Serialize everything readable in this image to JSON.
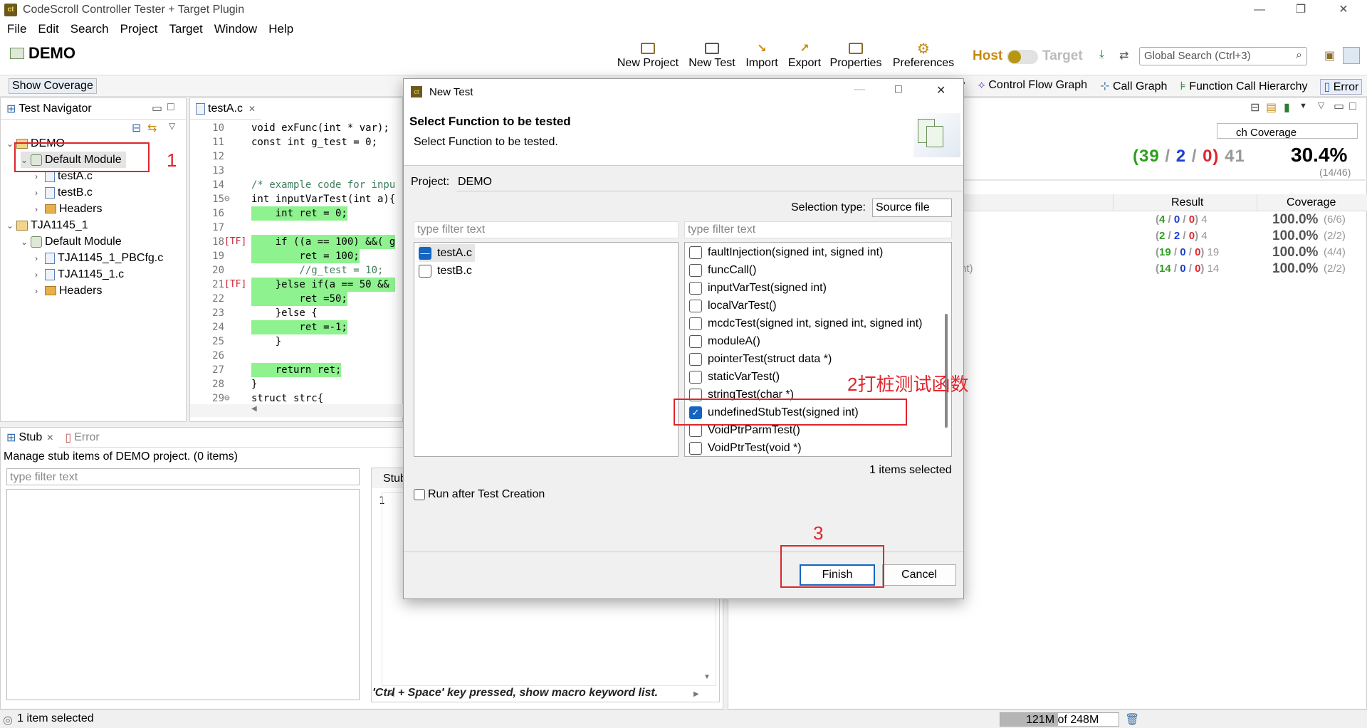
{
  "window": {
    "title": "CodeScroll Controller Tester + Target Plugin",
    "app_icon": "ct"
  },
  "menu": [
    "File",
    "Edit",
    "Search",
    "Project",
    "Target",
    "Window",
    "Help"
  ],
  "toolbar": {
    "project_name": "DEMO",
    "buttons": [
      "New Project",
      "New Test",
      "Import",
      "Export",
      "Properties",
      "Preferences"
    ],
    "host_label": "Host",
    "target_label": "Target",
    "search_placeholder": "Global Search (Ctrl+3)"
  },
  "viewbar": {
    "show_coverage": "Show Coverage",
    "right_views": [
      "ry",
      "Control Flow Graph",
      "Call Graph",
      "Function Call Hierarchy",
      "Error"
    ]
  },
  "navigator": {
    "tab": "Test Navigator",
    "tree": [
      {
        "label": "DEMO",
        "indent": 0,
        "icon": "project",
        "chev": "v"
      },
      {
        "label": "Default Module",
        "indent": 1,
        "icon": "module",
        "chev": "v",
        "selected": true
      },
      {
        "label": "testA.c",
        "indent": 2,
        "icon": "file",
        "chev": ">"
      },
      {
        "label": "testB.c",
        "indent": 2,
        "icon": "file",
        "chev": ">"
      },
      {
        "label": "Headers",
        "indent": 2,
        "icon": "folder",
        "chev": ">"
      },
      {
        "label": "TJA1145_1",
        "indent": 0,
        "icon": "project",
        "chev": "v"
      },
      {
        "label": "Default Module",
        "indent": 1,
        "icon": "module",
        "chev": "v"
      },
      {
        "label": "TJA1145_1_PBCfg.c",
        "indent": 2,
        "icon": "file",
        "chev": ">"
      },
      {
        "label": "TJA1145_1.c",
        "indent": 2,
        "icon": "file",
        "chev": ">"
      },
      {
        "label": "Headers",
        "indent": 2,
        "icon": "folder",
        "chev": ">"
      }
    ]
  },
  "editor": {
    "tab": "testA.c",
    "lines": [
      {
        "n": "10",
        "mark": "",
        "text": "void exFunc(int * var);",
        "hl": false
      },
      {
        "n": "11",
        "mark": "",
        "text": "const int g_test = 0;",
        "hl": false
      },
      {
        "n": "12",
        "mark": "",
        "text": "",
        "hl": false
      },
      {
        "n": "13",
        "mark": "",
        "text": "",
        "hl": false
      },
      {
        "n": "14",
        "mark": "",
        "text": "/* example code for inpu",
        "hl": false
      },
      {
        "n": "15",
        "mark": "⊖",
        "text": "int inputVarTest(int a){",
        "hl": false
      },
      {
        "n": "16",
        "mark": "",
        "text": "    int ret = 0;",
        "hl": true
      },
      {
        "n": "17",
        "mark": "",
        "text": "",
        "hl": false
      },
      {
        "n": "18",
        "mark": "[TF]",
        "text": "    if ((a == 100) &&( g",
        "hl": true
      },
      {
        "n": "19",
        "mark": "",
        "text": "        ret = 100;",
        "hl": true
      },
      {
        "n": "20",
        "mark": "",
        "text": "        //g_test = 10;",
        "hl": false
      },
      {
        "n": "21",
        "mark": "[TF]",
        "text": "    }else if(a == 50 && ",
        "hl": true
      },
      {
        "n": "22",
        "mark": "",
        "text": "        ret =50;",
        "hl": true
      },
      {
        "n": "23",
        "mark": "",
        "text": "    }else {",
        "hl": false
      },
      {
        "n": "24",
        "mark": "",
        "text": "        ret =-1;",
        "hl": true
      },
      {
        "n": "25",
        "mark": "",
        "text": "    }",
        "hl": false
      },
      {
        "n": "26",
        "mark": "",
        "text": "",
        "hl": false
      },
      {
        "n": "27",
        "mark": "",
        "text": "    return ret;",
        "hl": true
      },
      {
        "n": "28",
        "mark": "",
        "text": "}",
        "hl": false
      },
      {
        "n": "29",
        "mark": "⊖",
        "text": "struct strc{",
        "hl": false
      }
    ]
  },
  "coverage_panel": {
    "search_text": "ch Coverage",
    "summary_counts": [
      "(39",
      "2",
      "0)",
      "41"
    ],
    "summary_pct": "30.4%",
    "summary_ratio": "(14/46)",
    "headers": [
      "Result",
      "Coverage"
    ],
    "rows": [
      {
        "stub_left": "",
        "pass": "4",
        "fail": "0",
        "err": "0",
        "total": "4",
        "pct": "100.0%",
        "ratio": "(6/6)"
      },
      {
        "stub_left": ")",
        "pass": "2",
        "fail": "2",
        "err": "0",
        "total": "4",
        "pct": "100.0%",
        "ratio": "(2/2)"
      },
      {
        "stub_left": "",
        "pass": "19",
        "fail": "0",
        "err": "0",
        "total": "19",
        "pct": "100.0%",
        "ratio": "(4/4)"
      },
      {
        "stub_left": "nt)",
        "pass": "14",
        "fail": "0",
        "err": "0",
        "total": "14",
        "pct": "100.0%",
        "ratio": "(2/2)"
      }
    ]
  },
  "stub_panel": {
    "tabs": [
      "Stub",
      "Error"
    ],
    "description": "Manage stub items of DEMO project. (0 items)",
    "filter_placeholder": "type filter text",
    "right_title": "Stub",
    "line_no": "1",
    "hint": "'Ctrl + Space' key pressed, show macro keyword list."
  },
  "status": {
    "left": "1 item selected",
    "memory": "121M of 248M"
  },
  "dialog": {
    "title": "New Test",
    "heading": "Select Function to be tested",
    "subheading": "Select Function to be tested.",
    "project_label": "Project:",
    "project_value": "DEMO",
    "selection_type_label": "Selection type:",
    "selection_type_value": "Source file",
    "left_filter_placeholder": "type filter text",
    "right_filter_placeholder": "type filter text",
    "files": [
      {
        "name": "testA.c",
        "state": "partial"
      },
      {
        "name": "testB.c",
        "state": "off"
      }
    ],
    "functions": [
      {
        "name": "faultInjection(signed int, signed int)",
        "checked": false
      },
      {
        "name": "funcCall()",
        "checked": false
      },
      {
        "name": "inputVarTest(signed int)",
        "checked": false
      },
      {
        "name": "localVarTest()",
        "checked": false
      },
      {
        "name": "mcdcTest(signed int, signed int, signed int)",
        "checked": false
      },
      {
        "name": "moduleA()",
        "checked": false
      },
      {
        "name": "pointerTest(struct data *)",
        "checked": false
      },
      {
        "name": "staticVarTest()",
        "checked": false
      },
      {
        "name": "stringTest(char *)",
        "checked": false
      },
      {
        "name": "undefinedStubTest(signed int)",
        "checked": true
      },
      {
        "name": "VoidPtrParmTest()",
        "checked": false
      },
      {
        "name": "VoidPtrTest(void *)",
        "checked": false
      }
    ],
    "items_selected": "1 items selected",
    "run_after": "Run after Test Creation",
    "finish": "Finish",
    "cancel": "Cancel"
  },
  "annotations": {
    "a1": "1",
    "a2": "2打桩测试函数",
    "a3": "3"
  },
  "colors": {
    "accent": "#1565c0",
    "annotation": "#e0252c",
    "coverage_hl": "#8ef28e",
    "pass": "#2e9e1f",
    "fail": "#1c3fd1",
    "error": "#e0252c"
  }
}
